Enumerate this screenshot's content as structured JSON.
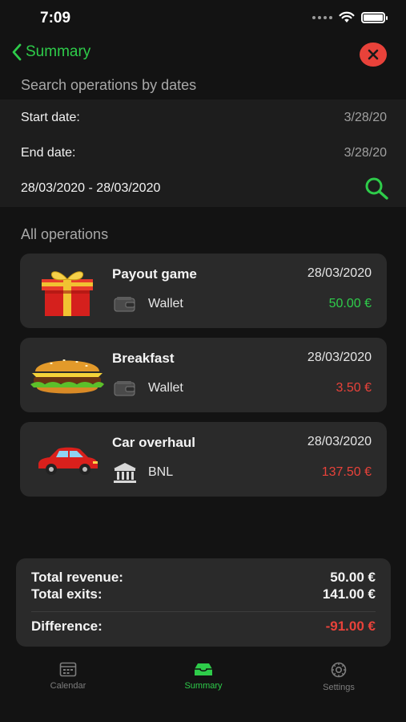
{
  "status_bar": {
    "time": "7:09"
  },
  "nav": {
    "back_label": "Summary"
  },
  "search": {
    "header": "Search operations by dates",
    "start_label": "Start date:",
    "start_value": "3/28/20",
    "end_label": "End date:",
    "end_value": "3/28/20",
    "range_text": "28/03/2020 - 28/03/2020"
  },
  "operations": {
    "header": "All operations",
    "items": [
      {
        "title": "Payout game",
        "date": "28/03/2020",
        "account": "Wallet",
        "amount": "50.00 €",
        "image": "gift-box-icon",
        "account_icon": "wallet-icon"
      },
      {
        "title": "Breakfast",
        "date": "28/03/2020",
        "account": "Wallet",
        "amount": "3.50 €",
        "image": "burger-icon",
        "account_icon": "wallet-icon"
      },
      {
        "title": "Car overhaul",
        "date": "28/03/2020",
        "account": "BNL",
        "amount": "137.50 €",
        "image": "car-icon",
        "account_icon": "bank-icon"
      }
    ]
  },
  "totals": {
    "revenue_label": "Total revenue:",
    "revenue_value": "50.00 €",
    "exits_label": "Total exits:",
    "exits_value": "141.00 €",
    "difference_label": "Difference:",
    "difference_value": "-91.00 €"
  },
  "tabs": [
    {
      "label": "Calendar",
      "icon": "calendar-icon",
      "active": false
    },
    {
      "label": "Summary",
      "icon": "summary-tray-icon",
      "active": true
    },
    {
      "label": "Settings",
      "icon": "gear-icon",
      "active": false
    }
  ],
  "colors": {
    "accent": "#2ecc4a",
    "income": "#2ecc4a",
    "expense": "#e8423a",
    "background": "#131313",
    "card": "#2a2a2a"
  }
}
